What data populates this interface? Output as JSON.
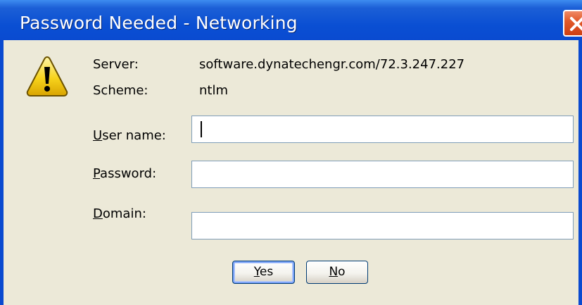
{
  "window": {
    "title": "Password Needed - Networking"
  },
  "icons": {
    "warning": "warning-triangle-icon",
    "close": "close-icon"
  },
  "colors": {
    "titlebar": "#0a4ad0",
    "dialog_bg": "#ece9d8",
    "close_button": "#e25a2b",
    "input_border": "#7f9db9",
    "button_border": "#003c74"
  },
  "info": {
    "server_label": "Server:",
    "server_value": "software.dynatechengr.com/72.3.247.227",
    "scheme_label": "Scheme:",
    "scheme_value": "ntlm"
  },
  "form": {
    "username": {
      "label_access": "U",
      "label_rest": "ser name:",
      "value": ""
    },
    "password": {
      "label_access": "P",
      "label_rest": "assword:",
      "value": ""
    },
    "domain": {
      "label_access": "D",
      "label_rest": "omain:",
      "value": ""
    }
  },
  "buttons": {
    "yes": {
      "access": "Y",
      "rest": "es"
    },
    "no": {
      "access": "N",
      "rest": "o"
    }
  }
}
